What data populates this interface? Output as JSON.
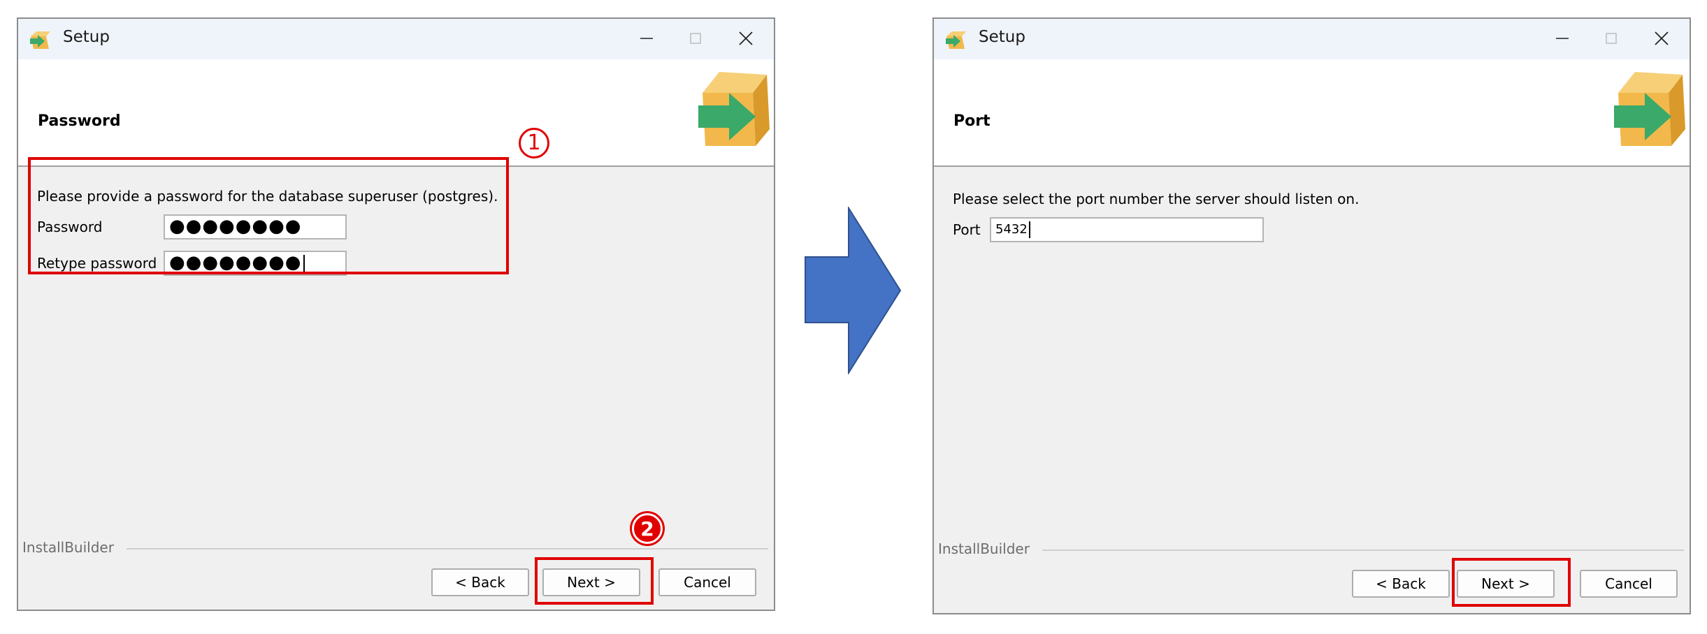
{
  "left_dialog": {
    "window_title": "Setup",
    "header_title": "Password",
    "instruction": "Please provide a password for the database superuser (postgres).",
    "password_label": "Password",
    "password_value": "●●●●●●●●",
    "retype_label": "Retype password",
    "retype_value": "●●●●●●●●",
    "brand": "InstallBuilder",
    "buttons": {
      "back": "< Back",
      "next": "Next >",
      "cancel": "Cancel"
    },
    "marker_1": "1",
    "marker_2": "2"
  },
  "right_dialog": {
    "window_title": "Setup",
    "header_title": "Port",
    "instruction": "Please select the port number the server should listen on.",
    "port_label": "Port",
    "port_value": "5432",
    "brand": "InstallBuilder",
    "buttons": {
      "back": "< Back",
      "next": "Next >",
      "cancel": "Cancel"
    }
  },
  "colors": {
    "highlight": "#e00000",
    "arrow": "#4472c4",
    "dialog_bg": "#f0f0f0",
    "header_bg": "#ffffff"
  },
  "icons": {
    "app": "installer-box-arrow-icon",
    "minimize": "minimize-icon",
    "maximize": "maximize-icon",
    "close": "close-icon",
    "flow": "right-arrow-icon"
  }
}
